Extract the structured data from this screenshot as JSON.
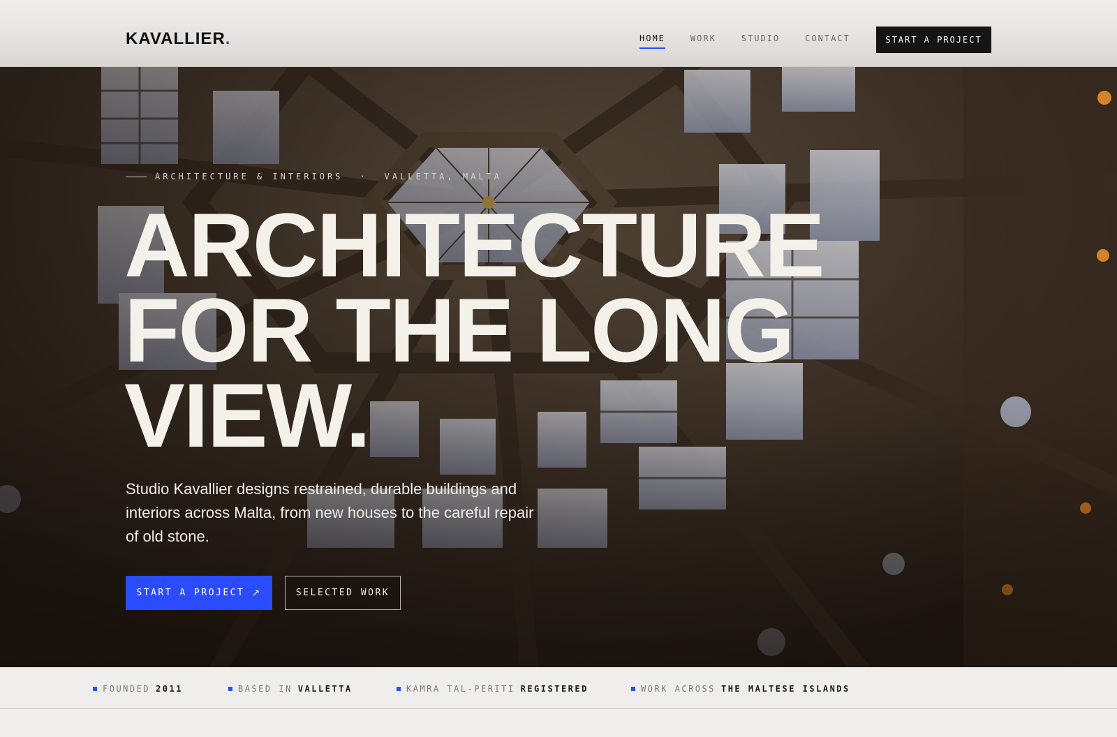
{
  "brand": {
    "name": "KAVALLIER",
    "dot": ".",
    "accent": "#2b4bff"
  },
  "nav": {
    "items": [
      {
        "label": "HOME",
        "active": true
      },
      {
        "label": "WORK",
        "active": false
      },
      {
        "label": "STUDIO",
        "active": false
      },
      {
        "label": "CONTACT",
        "active": false
      }
    ],
    "cta_label": "START A PROJECT"
  },
  "hero": {
    "eyebrow_left": "ARCHITECTURE & INTERIORS",
    "eyebrow_sep": "·",
    "eyebrow_right": "VALLETTA, MALTA",
    "headline_lines": [
      "ARCHITECTURE",
      "FOR THE LONG",
      "VIEW."
    ],
    "lede": "Studio Kavallier designs restrained, durable buildings and interiors across Malta, from new houses to the careful repair of old stone.",
    "primary_button": "START A PROJECT",
    "primary_button_icon": "arrow-up-right-icon",
    "secondary_button": "SELECTED WORK",
    "background_image": "dome-ceiling-photo"
  },
  "stats": [
    {
      "key": "FOUNDED",
      "value": "2011"
    },
    {
      "key": "BASED IN",
      "value": "VALLETTA"
    },
    {
      "key": "KAMRA TAL-PERITI",
      "value": "REGISTERED"
    },
    {
      "key": "WORK ACROSS",
      "value": "THE MALTESE ISLANDS"
    }
  ],
  "colors": {
    "accent": "#2b4bff",
    "headline": "#f4f1ea",
    "dark": "#151515",
    "paper": "#efeeec"
  }
}
